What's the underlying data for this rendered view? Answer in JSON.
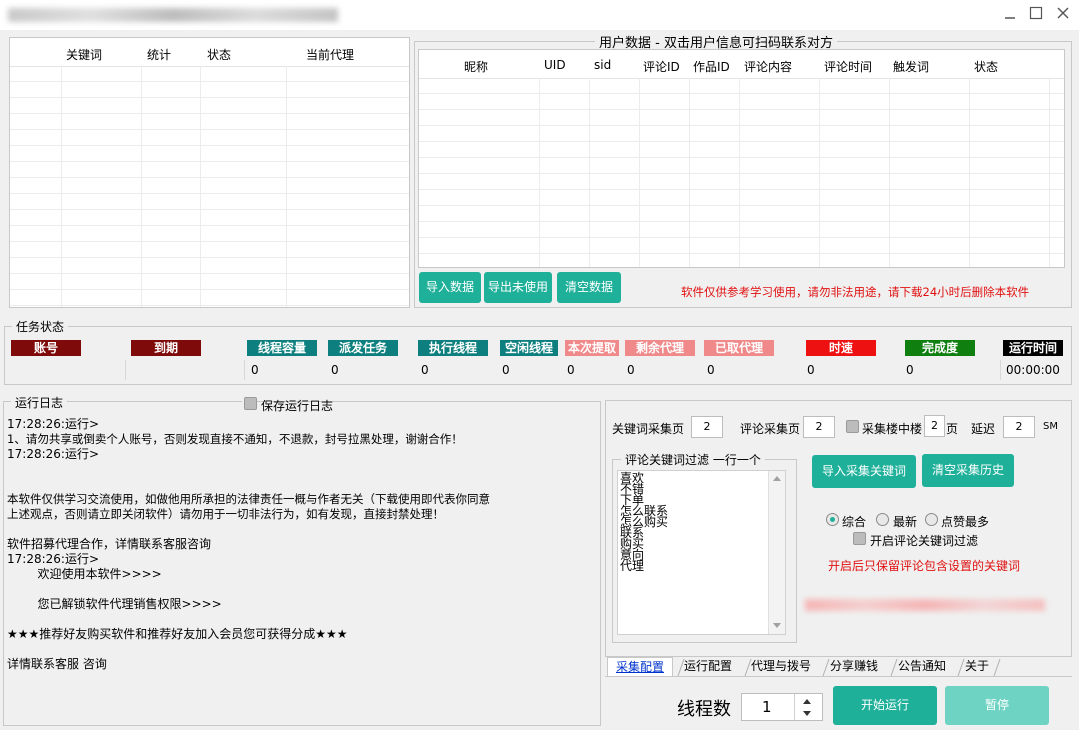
{
  "window": {
    "minimize_icon": "minimize-icon",
    "maximize_icon": "maximize-icon",
    "close_icon": "close-icon"
  },
  "keyword_table": {
    "columns": [
      "关键词",
      "统计",
      "状态",
      "当前代理"
    ]
  },
  "user_data": {
    "title": "用户数据  - 双击用户信息可扫码联系对方",
    "columns": [
      "昵称",
      "UID",
      "sid",
      "评论ID",
      "作品ID",
      "评论内容",
      "评论时间",
      "触发词",
      "状态"
    ],
    "buttons": {
      "import": "导入数据",
      "export_unused": "导出未使用",
      "clear": "清空数据"
    },
    "notice": "软件仅供参考学习使用，请勿非法用途，请下载24小时后删除本软件"
  },
  "task_status": {
    "title": "任务状态",
    "headers": {
      "account": "账号",
      "expire": "到期",
      "thread_capacity": "线程容量",
      "dispatch": "派发任务",
      "exec_thread": "执行线程",
      "idle_thread": "空闲线程",
      "this_extract": "本次提取",
      "remain_proxy": "剩余代理",
      "used_proxy": "已取代理",
      "speed": "时速",
      "completion": "完成度",
      "runtime": "运行时间"
    },
    "values": {
      "thread_capacity": "0",
      "dispatch": "0",
      "exec_thread": "0",
      "idle_thread": "0",
      "this_extract": "0",
      "remain_proxy": "0",
      "used_proxy": "0",
      "speed": "0",
      "completion": "0",
      "runtime": "00:00:00"
    },
    "colors": {
      "dark_red": "#7f0a0a",
      "teal": "#0e7f7f",
      "pink": "#f08a8a",
      "red": "#ee1111",
      "green": "#0f7f0f",
      "black": "#000000"
    }
  },
  "run_log": {
    "title": "运行日志",
    "save_label": "保存运行日志",
    "lines": [
      "17:28:26:运行>",
      "1、请勿共享或倒卖个人账号，否则发现直接不通知，不退款，封号拉黑处理，谢谢合作！",
      "17:28:26:运行>",
      "",
      "",
      "本软件仅供学习交流使用，如做他用所承担的法律责任一概与作者无关（下载使用即代表你同意",
      "上述观点，否则请立即关闭软件）请勿用于一切非法行为，如有发现，直接封禁处理！",
      "",
      "软件招募代理合作，详情联系客服咨询",
      "17:28:26:运行>",
      "        欢迎使用本软件>>>>",
      "",
      "        您已解锁软件代理销售权限>>>>",
      "",
      "★★★推荐好友购买软件和推荐好友加入会员您可获得分成★★★",
      "",
      "详情联系客服  咨询"
    ]
  },
  "config": {
    "kw_pages_label": "关键词采集页",
    "kw_pages_value": "2",
    "comment_pages_label": "评论采集页",
    "comment_pages_value": "2",
    "floor_label": "采集楼中楼",
    "floor_value": "2",
    "floor_unit": "页",
    "delay_label": "延迟",
    "delay_value": "2",
    "delay_unit": "SM",
    "filter_title": "评论关键词过滤 一行一个",
    "filter_words": [
      "喜欢",
      "不错",
      "下单",
      "怎么联系",
      "怎么购买",
      "联系",
      "购买",
      "意向",
      "代理"
    ],
    "import_btn": "导入采集关键词",
    "clear_history_btn": "清空采集历史",
    "sort_options": [
      "综合",
      "最新",
      "点赞最多"
    ],
    "filter_toggle_label": "开启评论关键词过滤",
    "filter_hint": "开启后只保留评论包含设置的关键词"
  },
  "tabs": [
    "采集配置",
    "运行配置",
    "代理与拨号",
    "分享赚钱",
    "公告通知",
    "关于"
  ],
  "footer": {
    "threads_label": "线程数",
    "threads_value": "1",
    "start_btn": "开始运行",
    "pause_btn": "暂停"
  }
}
